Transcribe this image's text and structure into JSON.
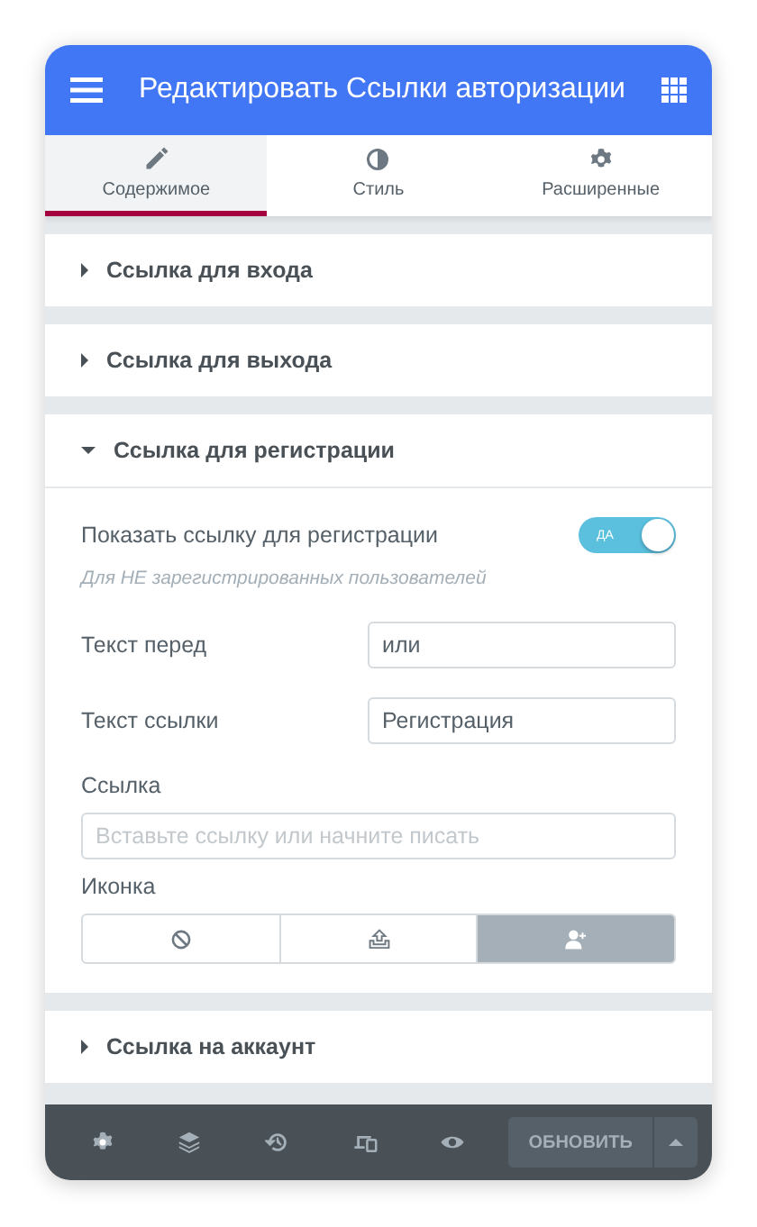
{
  "header": {
    "title": "Редактировать Ссылки авторизации"
  },
  "tabs": [
    {
      "label": "Содержимое",
      "selected": true
    },
    {
      "label": "Стиль",
      "selected": false
    },
    {
      "label": "Расширенные",
      "selected": false
    }
  ],
  "sections": [
    {
      "title": "Ссылка для входа",
      "expanded": false
    },
    {
      "title": "Ссылка для выхода",
      "expanded": false
    },
    {
      "title": "Ссылка для регистрации",
      "expanded": true,
      "controls": [
        {
          "kind": "switch",
          "label": "Показать ссылку для регистрации",
          "on": true,
          "switch_text": "ДА"
        },
        {
          "kind": "note",
          "text": "Для НЕ зарегистрированных пользователей"
        },
        {
          "kind": "text",
          "label": "Текст перед",
          "value": "или"
        },
        {
          "kind": "text",
          "label": "Текст ссылки",
          "value": "Регистрация"
        },
        {
          "kind": "url",
          "label": "Ссылка",
          "placeholder": "Вставьте ссылку или начните писать"
        },
        {
          "kind": "choices",
          "label": "Иконка",
          "options": [
            {
              "selected": false
            },
            {
              "selected": false
            },
            {
              "selected": true
            }
          ]
        }
      ]
    },
    {
      "title": "Ссылка на аккаунт",
      "expanded": false
    }
  ],
  "footer": {
    "button": "ОБНОВИТЬ"
  }
}
